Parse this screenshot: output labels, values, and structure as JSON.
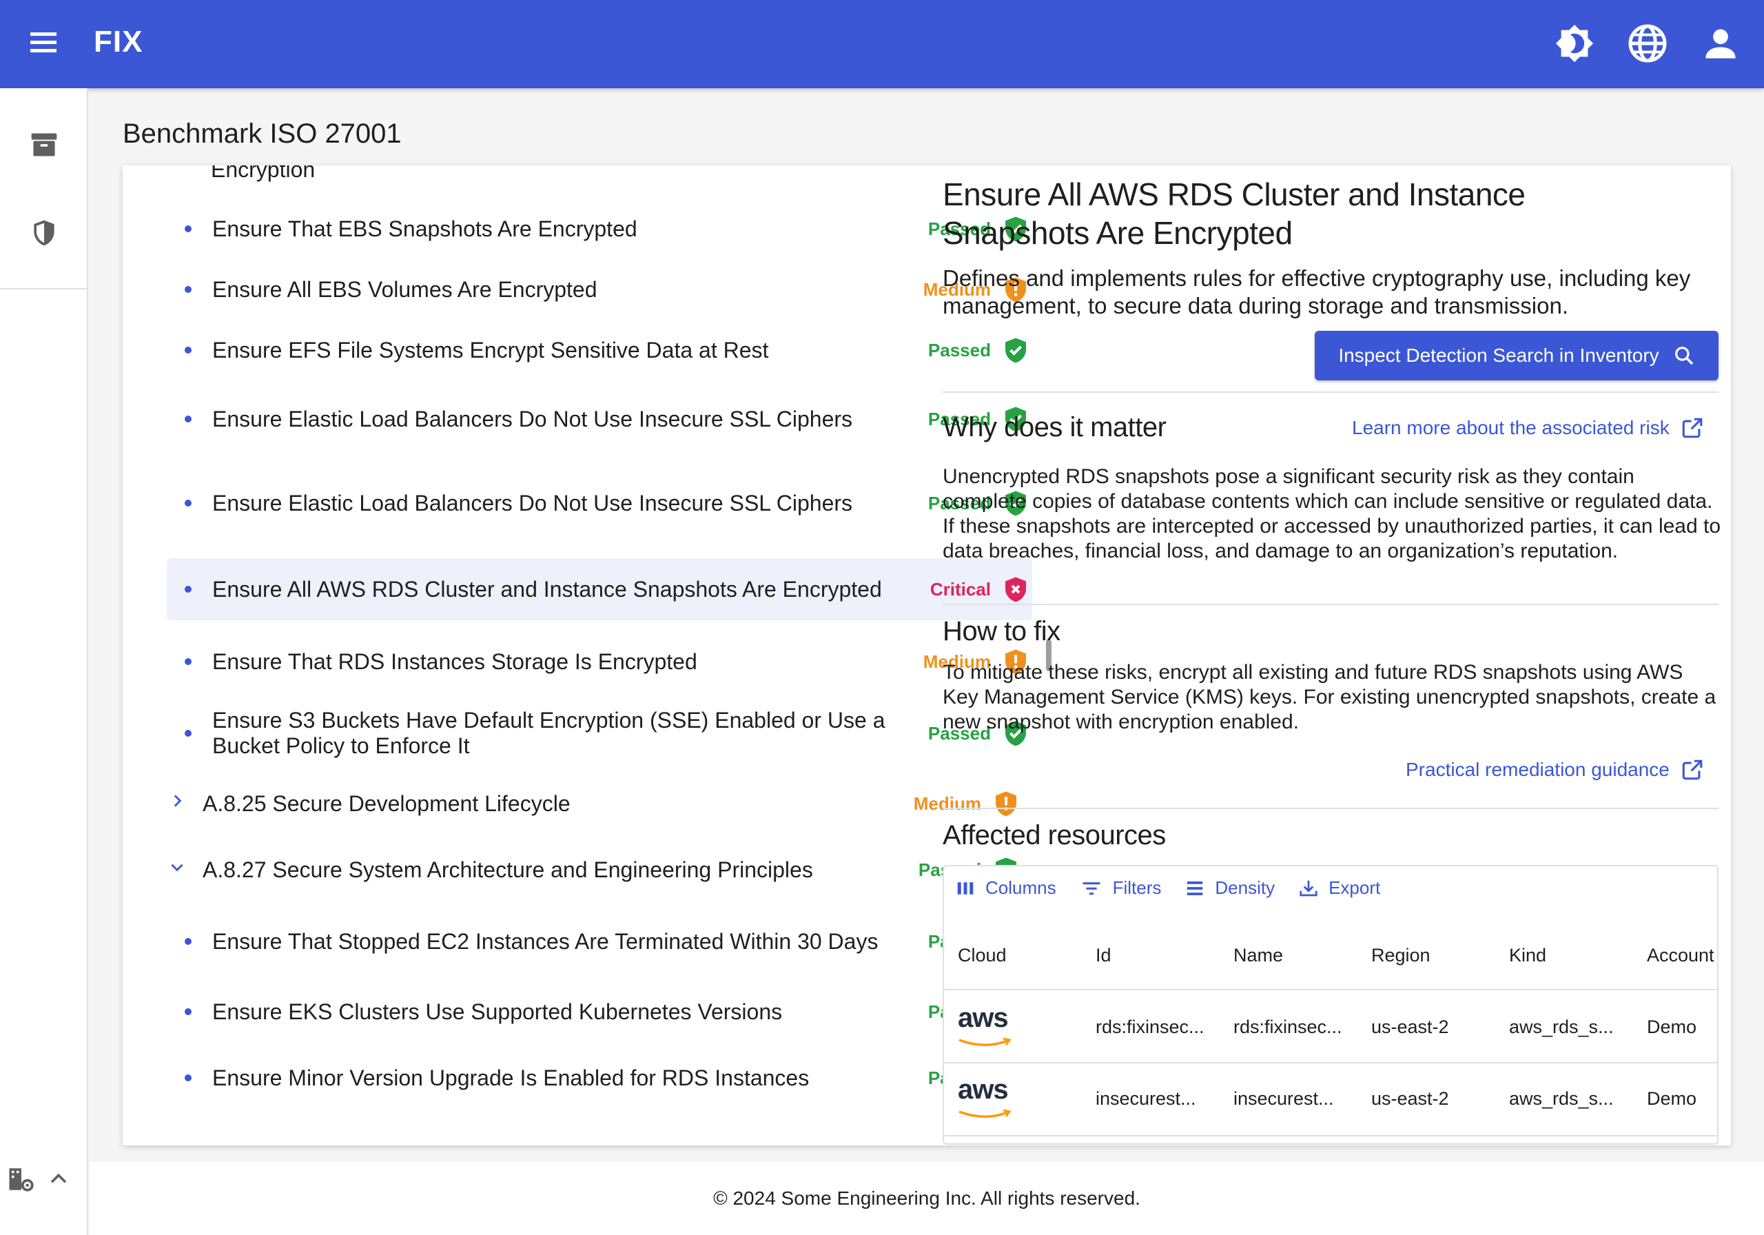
{
  "app": {
    "brand": "FIX"
  },
  "page": {
    "title": "Benchmark ISO 27001"
  },
  "list": {
    "cutoff_text": "Encryption",
    "items": [
      {
        "label": "Ensure That EBS Snapshots Are Encrypted",
        "status": "Passed"
      },
      {
        "label": "Ensure All EBS Volumes Are Encrypted",
        "status": "Medium"
      },
      {
        "label": "Ensure EFS File Systems Encrypt Sensitive Data at Rest",
        "status": "Passed"
      },
      {
        "label": "Ensure Elastic Load Balancers Do Not Use Insecure SSL Ciphers",
        "status": "Passed"
      },
      {
        "label": "Ensure Elastic Load Balancers Do Not Use Insecure SSL Ciphers",
        "status": "Passed"
      },
      {
        "label": "Ensure All AWS RDS Cluster and Instance Snapshots Are Encrypted",
        "status": "Critical"
      },
      {
        "label": "Ensure That RDS Instances Storage Is Encrypted",
        "status": "Medium"
      },
      {
        "label": "Ensure S3 Buckets Have Default Encryption (SSE) Enabled or Use a Bucket Policy to Enforce It",
        "status": "Passed"
      },
      {
        "label": "A.8.25 Secure Development Lifecycle",
        "status": "Medium"
      },
      {
        "label": "A.8.27 Secure System Architecture and Engineering Principles",
        "status": "Passed"
      },
      {
        "label": "Ensure That Stopped EC2 Instances Are Terminated Within 30 Days",
        "status": "Passed"
      },
      {
        "label": "Ensure EKS Clusters Use Supported Kubernetes Versions",
        "status": "Passed"
      },
      {
        "label": "Ensure Minor Version Upgrade Is Enabled for RDS Instances",
        "status": "Passed"
      }
    ]
  },
  "detail": {
    "title": "Ensure All AWS RDS Cluster and Instance Snapshots Are Encrypted",
    "description": "Defines and implements rules for effective cryptography use, including key management, to secure data during storage and transmission.",
    "inspect_button": "Inspect Detection Search in Inventory",
    "why_title": "Why does it matter",
    "why_link": "Learn more about the associated risk",
    "why_text": "Unencrypted RDS snapshots pose a significant security risk as they contain complete copies of database contents which can include sensitive or regulated data. If these snapshots are intercepted or accessed by unauthorized parties, it can lead to data breaches, financial loss, and damage to an organization’s reputation.",
    "fix_title": "How to fix",
    "fix_text": "To mitigate these risks, encrypt all existing and future RDS snapshots using AWS Key Management Service (KMS) keys. For existing unencrypted snapshots, create a new snapshot with encryption enabled.",
    "fix_link": "Practical remediation guidance",
    "affected_title": "Affected resources",
    "toolbar": {
      "columns": "Columns",
      "filters": "Filters",
      "density": "Density",
      "export": "Export"
    },
    "columns": [
      "Cloud",
      "Id",
      "Name",
      "Region",
      "Kind",
      "Account"
    ],
    "rows": [
      {
        "cloud": "aws",
        "id": "rds:fixinsec...",
        "name": "rds:fixinsec...",
        "region": "us-east-2",
        "kind": "aws_rds_s...",
        "account": "Demo"
      },
      {
        "cloud": "aws",
        "id": "insecurest...",
        "name": "insecurest...",
        "region": "us-east-2",
        "kind": "aws_rds_s...",
        "account": "Demo"
      }
    ]
  },
  "footer": {
    "text": "© 2024 Some Engineering Inc. All rights reserved."
  },
  "colors": {
    "primary": "#3b57d6",
    "passed": "#27a243",
    "medium": "#f0901c",
    "critical": "#e0245e"
  }
}
